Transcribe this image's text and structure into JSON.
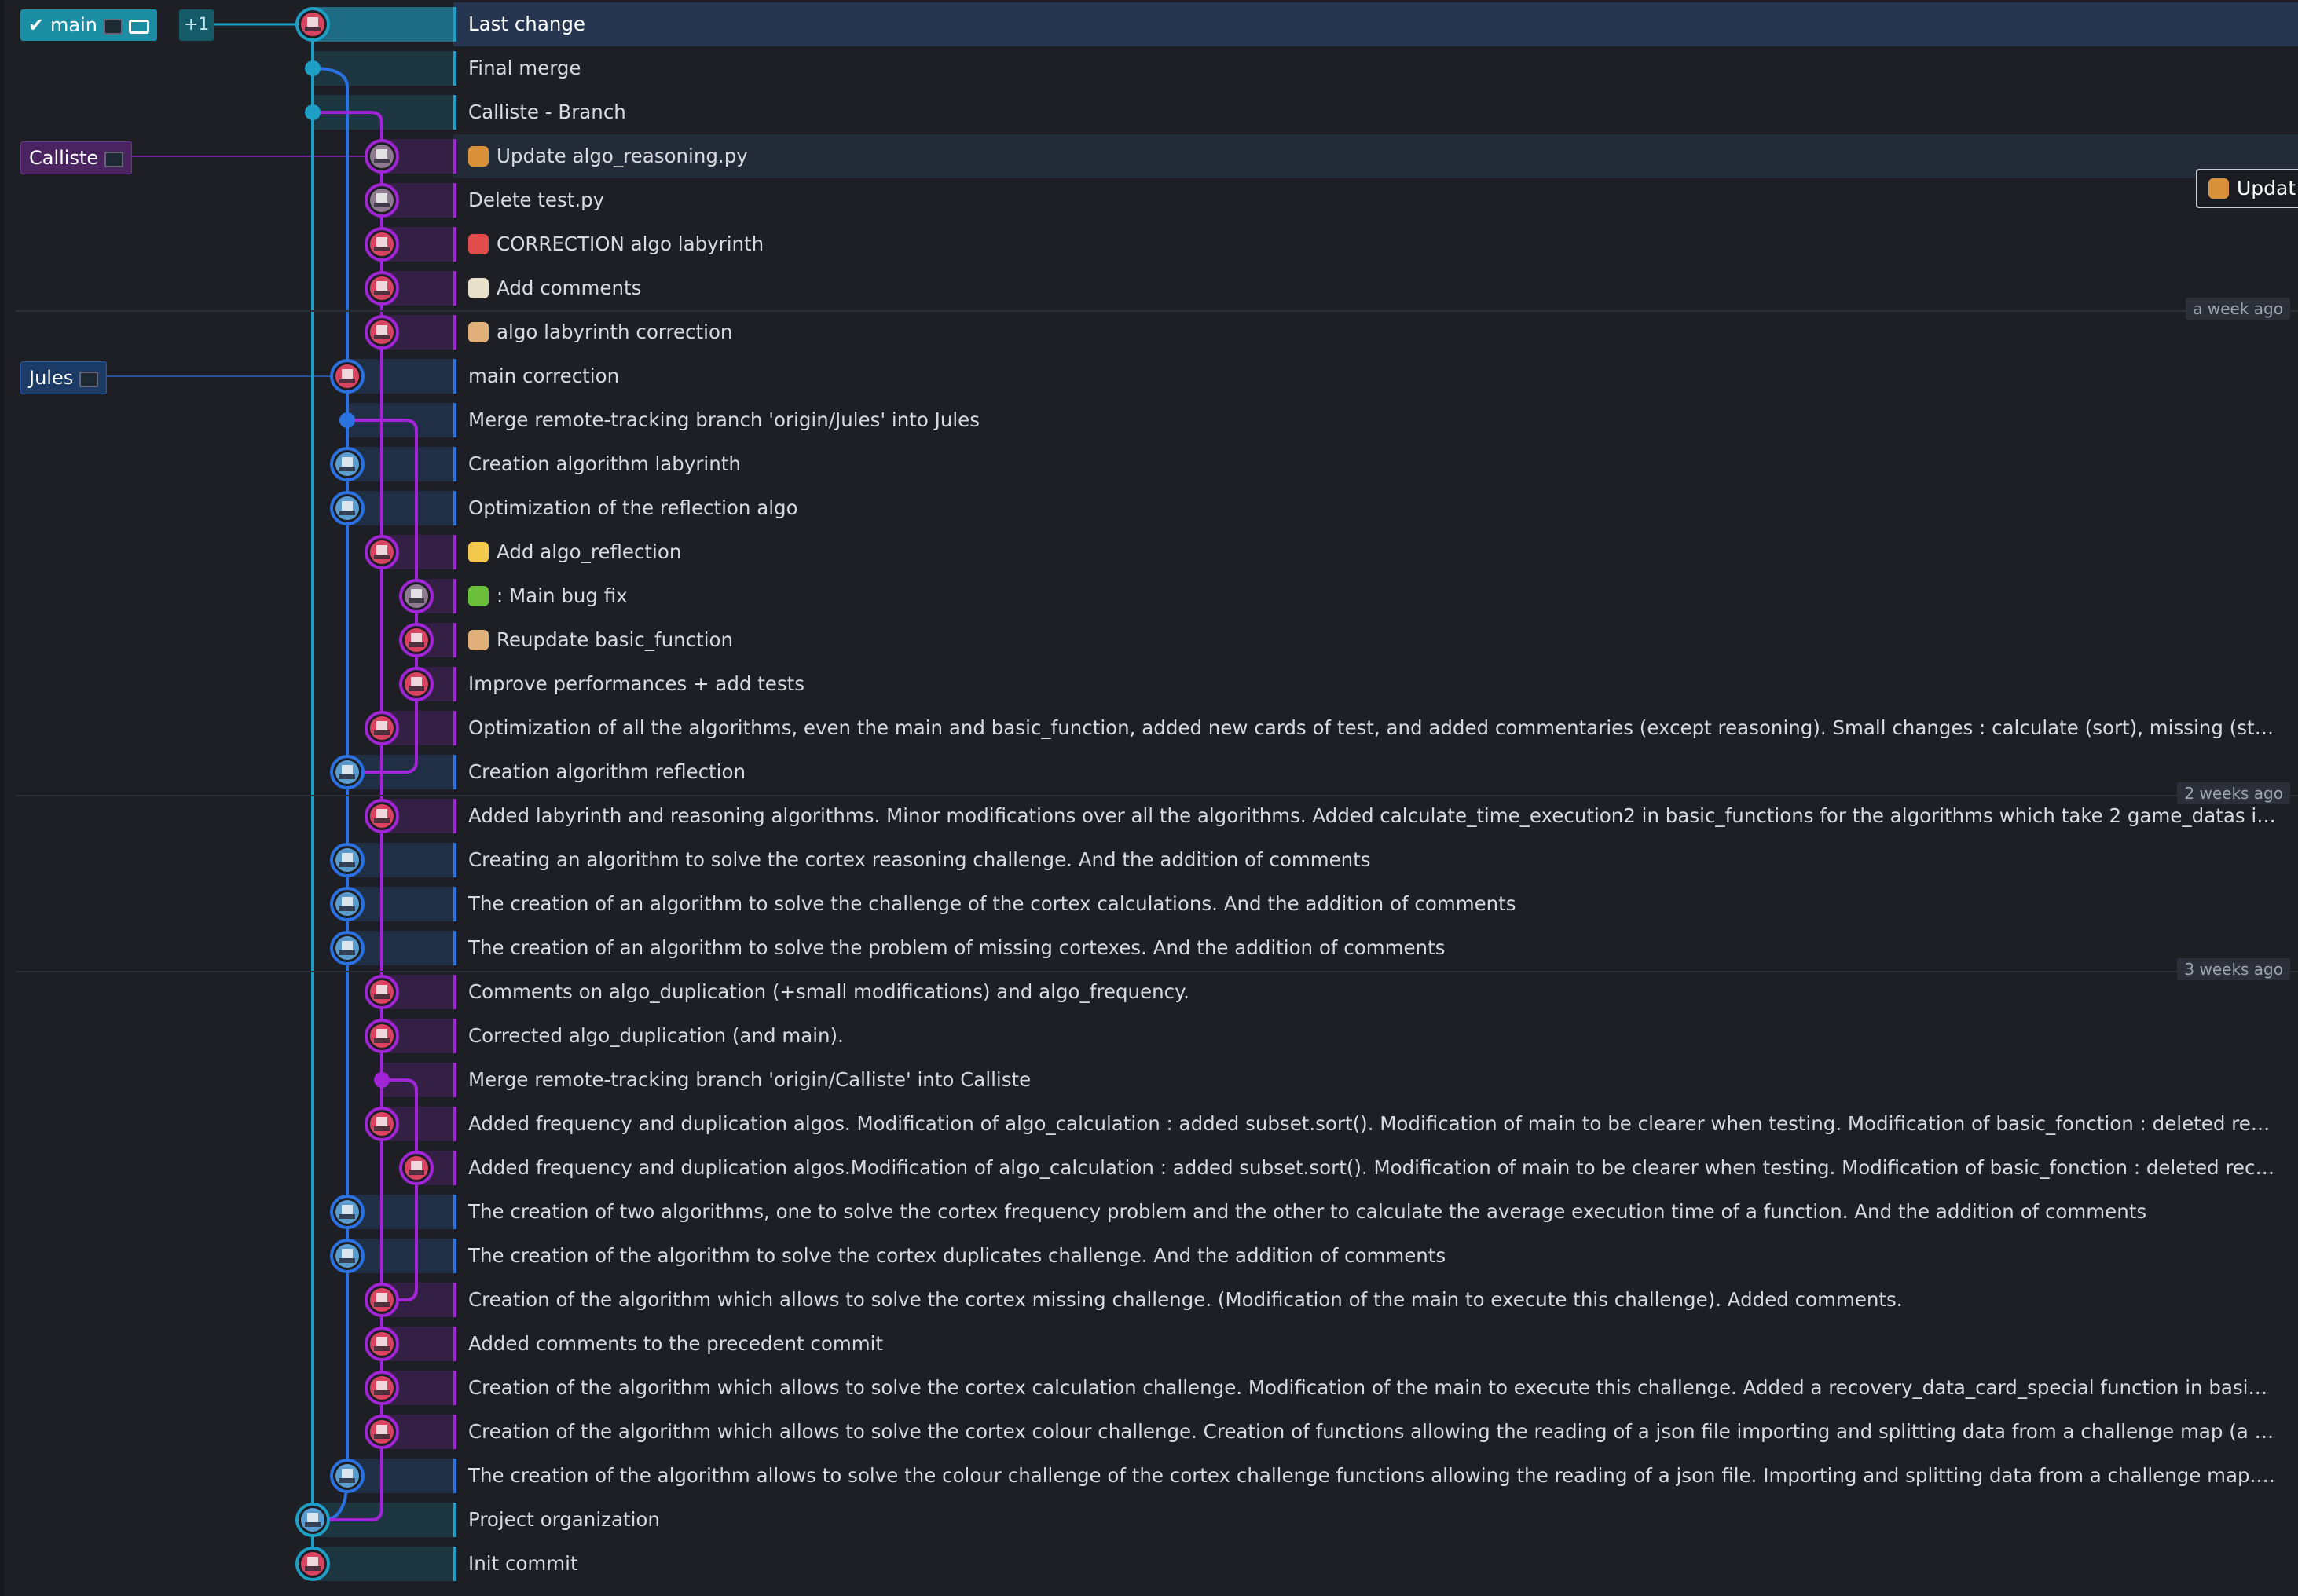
{
  "refs": {
    "main": {
      "label": "main",
      "extra": "+1"
    },
    "callisto": {
      "label": "Calliste"
    },
    "jules": {
      "label": "Jules"
    }
  },
  "tooltip": {
    "text": "Updat"
  },
  "date_labels": [
    "a week ago",
    "2 weeks ago",
    "3 weeks ago"
  ],
  "colors": {
    "main_lane": "#1e9fc6",
    "jules_lane": "#2a72e0",
    "callisto_lane": "#a125d6",
    "selection": "#263550",
    "background": "#1e1f25"
  },
  "commits": [
    {
      "message": "Last change",
      "emoji": "",
      "lane": 0,
      "avatar": "red",
      "merge": false,
      "selected": true
    },
    {
      "message": "Final merge",
      "emoji": "",
      "lane": 0,
      "avatar": "dot",
      "merge": true
    },
    {
      "message": "Calliste - Branch",
      "emoji": "",
      "lane": 0,
      "avatar": "dot",
      "merge": true
    },
    {
      "message": "Update algo_reasoning.py",
      "emoji": "palette",
      "lane": 2,
      "avatar": "grey",
      "merge": false,
      "highlight": true
    },
    {
      "message": "Delete test.py",
      "emoji": "",
      "lane": 2,
      "avatar": "grey",
      "merge": false
    },
    {
      "message": "CORRECTION algo labyrinth",
      "emoji": "ambulance",
      "lane": 2,
      "avatar": "red",
      "merge": false
    },
    {
      "message": "Add comments",
      "emoji": "memo",
      "lane": 2,
      "avatar": "red",
      "merge": false
    },
    {
      "message": "algo labyrinth correction",
      "emoji": "bandage",
      "lane": 2,
      "avatar": "red",
      "merge": false
    },
    {
      "message": "main correction",
      "emoji": "",
      "lane": 1,
      "avatar": "red",
      "merge": false
    },
    {
      "message": "Merge remote-tracking branch 'origin/Jules' into Jules",
      "emoji": "",
      "lane": 1,
      "avatar": "dot",
      "merge": true
    },
    {
      "message": "Creation algorithm labyrinth",
      "emoji": "",
      "lane": 1,
      "avatar": "green",
      "merge": false
    },
    {
      "message": "Optimization of the reflection algo",
      "emoji": "",
      "lane": 1,
      "avatar": "green",
      "merge": false
    },
    {
      "message": "Add algo_reflection",
      "emoji": "sparkles",
      "lane": 2,
      "avatar": "red",
      "merge": false
    },
    {
      "message": ": Main bug fix",
      "emoji": "bug",
      "lane": 3,
      "avatar": "grey",
      "merge": false
    },
    {
      "message": "Reupdate basic_function",
      "emoji": "bandage",
      "lane": 3,
      "avatar": "red",
      "merge": false
    },
    {
      "message": "Improve performances + add tests",
      "emoji": "",
      "lane": 3,
      "avatar": "red",
      "merge": false
    },
    {
      "message": "Optimization of all the algorithms, even the main and basic_function, added new cards of test, and added commentaries (except reasoning). Small changes : calculate (sort), missing (start now by the shorte...",
      "emoji": "",
      "lane": 2,
      "avatar": "red",
      "merge": false
    },
    {
      "message": "Creation algorithm reflection",
      "emoji": "",
      "lane": 1,
      "avatar": "green",
      "merge": false
    },
    {
      "message": "Added labyrinth and reasoning algorithms. Minor modifications over all the algorithms. Added calculate_time_execution2 in basic_functions for the algorithms which take 2 game_datas in parameter. Subse...",
      "emoji": "",
      "lane": 2,
      "avatar": "red",
      "merge": false
    },
    {
      "message": "Creating an algorithm to solve the cortex reasoning challenge. And the addition of comments",
      "emoji": "",
      "lane": 1,
      "avatar": "green",
      "merge": false
    },
    {
      "message": "The creation of an algorithm to solve the challenge of the cortex calculations. And the addition of comments",
      "emoji": "",
      "lane": 1,
      "avatar": "green",
      "merge": false
    },
    {
      "message": "The creation of an algorithm to solve the problem of missing cortexes. And the addition of comments",
      "emoji": "",
      "lane": 1,
      "avatar": "green",
      "merge": false
    },
    {
      "message": "Comments on algo_duplication (+small modifications) and algo_frequency.",
      "emoji": "",
      "lane": 2,
      "avatar": "red",
      "merge": false
    },
    {
      "message": "Corrected algo_duplication (and main).",
      "emoji": "",
      "lane": 2,
      "avatar": "red",
      "merge": false
    },
    {
      "message": "Merge remote-tracking branch 'origin/Calliste' into Calliste",
      "emoji": "",
      "lane": 2,
      "avatar": "dot",
      "merge": true
    },
    {
      "message": "Added frequency and duplication algos. Modification of algo_calculation : added subset.sort(). Modification of main to be clearer when testing. Modification of basic_fonction : deleted recovery_data_card_s...",
      "emoji": "",
      "lane": 2,
      "avatar": "red",
      "merge": false
    },
    {
      "message": "Added frequency and duplication algos.Modification of algo_calculation : added subset.sort(). Modification of main to be clearer when testing. Modification of basic_fonction : deleted recovery_data_card_sp...",
      "emoji": "",
      "lane": 3,
      "avatar": "red",
      "merge": false
    },
    {
      "message": "The creation of two algorithms, one to solve the cortex frequency problem and the other to calculate the average execution time of a function. And the addition of comments",
      "emoji": "",
      "lane": 1,
      "avatar": "green",
      "merge": false
    },
    {
      "message": "The creation of the algorithm to solve the cortex duplicates challenge. And the addition of comments",
      "emoji": "",
      "lane": 1,
      "avatar": "green",
      "merge": false
    },
    {
      "message": "Creation of the algorithm which allows to solve the cortex missing challenge. (Modification of the main to execute this challenge). Added comments.",
      "emoji": "",
      "lane": 2,
      "avatar": "red",
      "merge": false
    },
    {
      "message": "Added comments to the precedent commit",
      "emoji": "",
      "lane": 2,
      "avatar": "red",
      "merge": false
    },
    {
      "message": "Creation of the algorithm which allows to solve the cortex calculation challenge. Modification of the main to execute this challenge. Added a recovery_data_card_special function in basic_fonction which per...",
      "emoji": "",
      "lane": 2,
      "avatar": "red",
      "merge": false
    },
    {
      "message": "Creation of the algorithm which allows to solve the cortex colour challenge. Creation of functions allowing the reading of a json file importing and splitting data from a challenge map (a card). Addition of co...",
      "emoji": "",
      "lane": 2,
      "avatar": "red",
      "merge": false
    },
    {
      "message": "The creation of the algorithm allows to solve the colour challenge of the cortex challenge functions allowing the reading of a json file. Importing and splitting data from a challenge map. And the addition of ...",
      "emoji": "",
      "lane": 1,
      "avatar": "green",
      "merge": false
    },
    {
      "message": "Project organization",
      "emoji": "",
      "lane": 0,
      "avatar": "green",
      "merge": false
    },
    {
      "message": "Init commit",
      "emoji": "",
      "lane": 0,
      "avatar": "red",
      "merge": false
    }
  ]
}
